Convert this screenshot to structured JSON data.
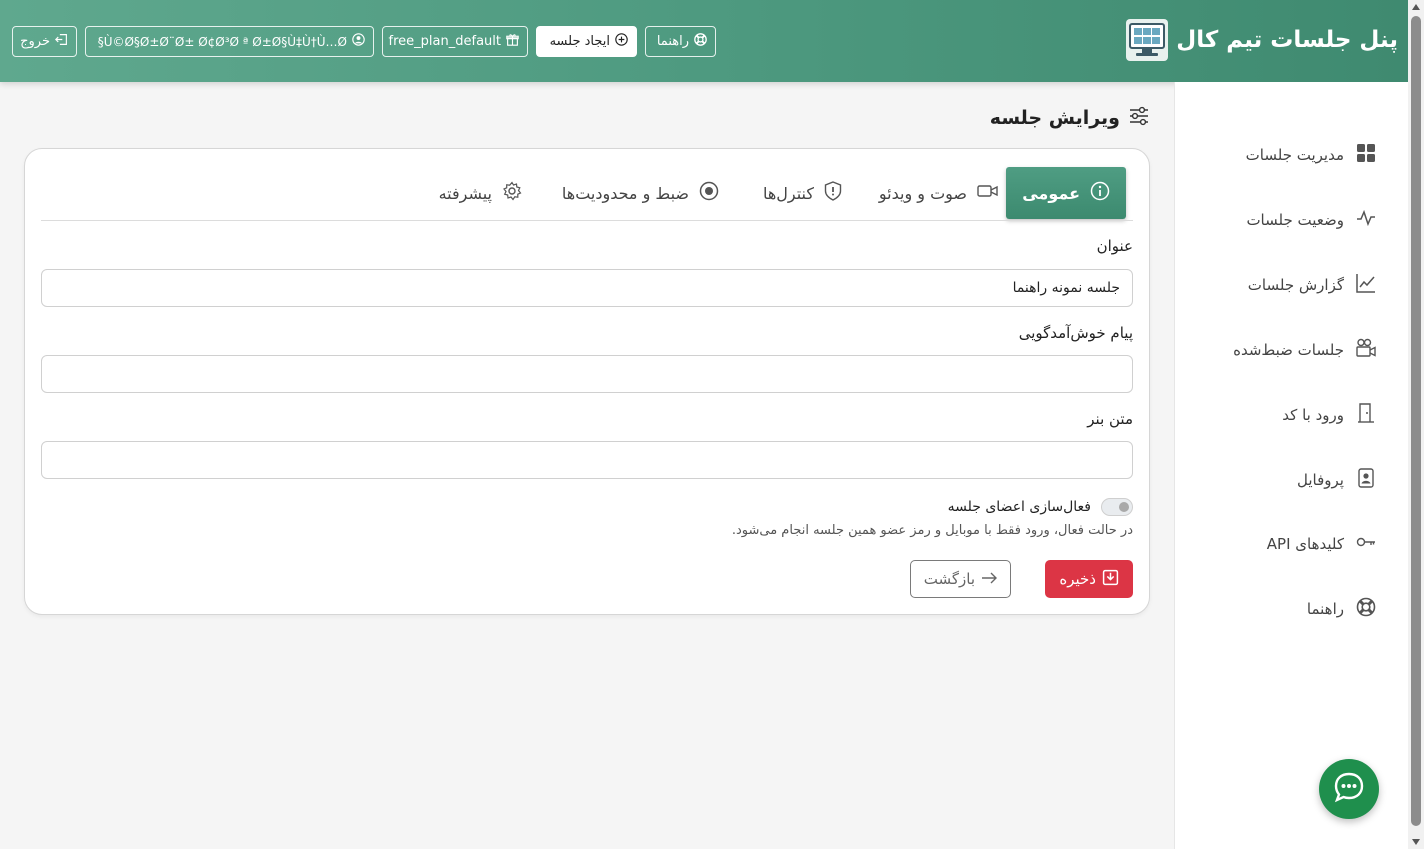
{
  "header": {
    "brand_title": "پنل جلسات تیم کال",
    "help_label": "راهنما",
    "create_meeting_label": "ایجاد جلسه",
    "plan_label": "free_plan_default",
    "user_label": "§Ù©Ø§Ø±Ø¨Ø± Ø¢Ø³Ø ª Ø±Ø§Ù‡Ù†Ù…Ø",
    "logout_label": "خروج",
    "bg_color": "#4e9a80"
  },
  "sidebar": {
    "items": [
      {
        "label": "مدیریت جلسات",
        "icon": "grid-icon"
      },
      {
        "label": "وضعیت جلسات",
        "icon": "activity-icon"
      },
      {
        "label": "گزارش جلسات",
        "icon": "chart-line-icon"
      },
      {
        "label": "جلسات ضبط‌شده",
        "icon": "camera-reels-icon"
      },
      {
        "label": "ورود با کد",
        "icon": "door-icon"
      },
      {
        "label": "پروفایل",
        "icon": "person-badge-icon"
      },
      {
        "label": "کلیدهای API",
        "icon": "key-icon"
      },
      {
        "label": "راهنما",
        "icon": "life-ring-icon"
      }
    ]
  },
  "main": {
    "page_title": "ویرایش جلسه",
    "tabs": [
      {
        "label": "عمومی",
        "icon": "info-circle-icon",
        "active": true
      },
      {
        "label": "صوت و ویدئو",
        "icon": "camera-video-icon",
        "active": false
      },
      {
        "label": "کنترل‌ها",
        "icon": "shield-icon",
        "active": false
      },
      {
        "label": "ضبط و محدودیت‌ها",
        "icon": "record-circle-icon",
        "active": false
      },
      {
        "label": "پیشرفته",
        "icon": "gear-icon",
        "active": false
      }
    ],
    "form": {
      "title_label": "عنوان",
      "title_value": "جلسه نمونه راهنما",
      "welcome_label": "پیام خوش‌آمدگویی",
      "welcome_value": "",
      "banner_label": "متن بنر",
      "banner_value": "",
      "toggle_label": "فعال‌سازی اعضای جلسه",
      "toggle_on": false,
      "help_text": "در حالت فعال، ورود فقط با موبایل و رمز عضو همین جلسه انجام می‌شود.",
      "save_label": "ذخیره",
      "back_label": "بازگشت"
    },
    "save_color": "#dc3545",
    "active_tab_color": "#4a9a80"
  },
  "chat_button": {
    "icon": "chat-dots-icon",
    "color": "#1f8f4d"
  }
}
